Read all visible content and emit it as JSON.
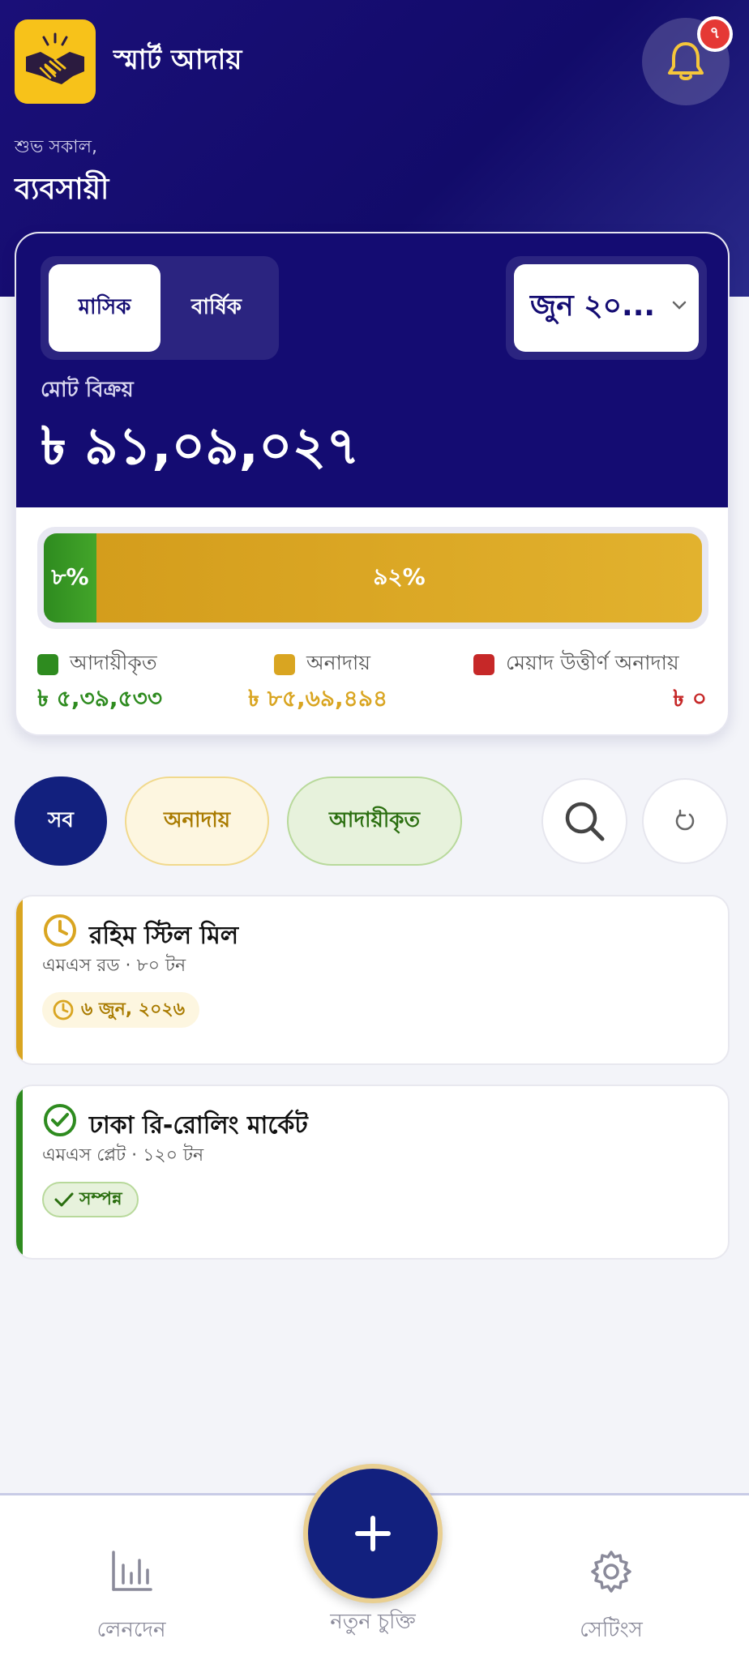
{
  "header": {
    "app_title": "স্মার্ট আদায়",
    "notification_count": "৭",
    "greeting": "শুভ সকাল,",
    "user_name": "ব্যবসায়ী"
  },
  "summary": {
    "toggle_monthly": "মাসিক",
    "toggle_yearly": "বার্ষিক",
    "month_selected": "জুন ২০...",
    "total_label": "মোট বিক্রয়",
    "total_amount": "৳ ৯১,০৯,০২৭",
    "progress": {
      "collected_percent": 8,
      "collected_label": "৮%",
      "due_percent": 92,
      "due_label": "৯২%"
    },
    "legend": {
      "collected_label": "আদায়ীকৃত",
      "collected_value": "৳ ৫,৩৯,৫৩৩",
      "due_label": "অনাদায়",
      "due_value": "৳ ৮৫,৬৯,৪৯৪",
      "overdue_label": "মেয়াদ উত্তীর্ণ অনাদায়",
      "overdue_value": "৳ ০"
    }
  },
  "filters": {
    "all": "সব",
    "due": "অনাদায়",
    "collected": "আদায়ীকৃত"
  },
  "deals": [
    {
      "name": "রহিম স্টিল মিল",
      "details": "এমএস রড · ৮০ টন",
      "badge": "৬ জুন, ২০২৬"
    },
    {
      "name": "ঢাকা রি-রোলিং মার্কেট",
      "details": "এমএস প্লেট · ১২০ টন",
      "badge": "সম্পন্ন"
    }
  ],
  "nav": {
    "transactions": "লেনদেন",
    "new_contract": "নতুন চুক্তি",
    "settings": "সেটিংস"
  },
  "colors": {
    "primary": "#140c72",
    "collected": "#2e8b1f",
    "due": "#d9a521",
    "overdue": "#c62828"
  },
  "icons": {
    "logo": "handshake-icon",
    "bell": "bell-icon",
    "search": "search-icon",
    "refresh": "refresh-icon",
    "clock": "clock-icon",
    "check": "check-circle-icon",
    "chart": "bar-chart-icon",
    "gear": "gear-icon",
    "plus": "plus-icon"
  }
}
